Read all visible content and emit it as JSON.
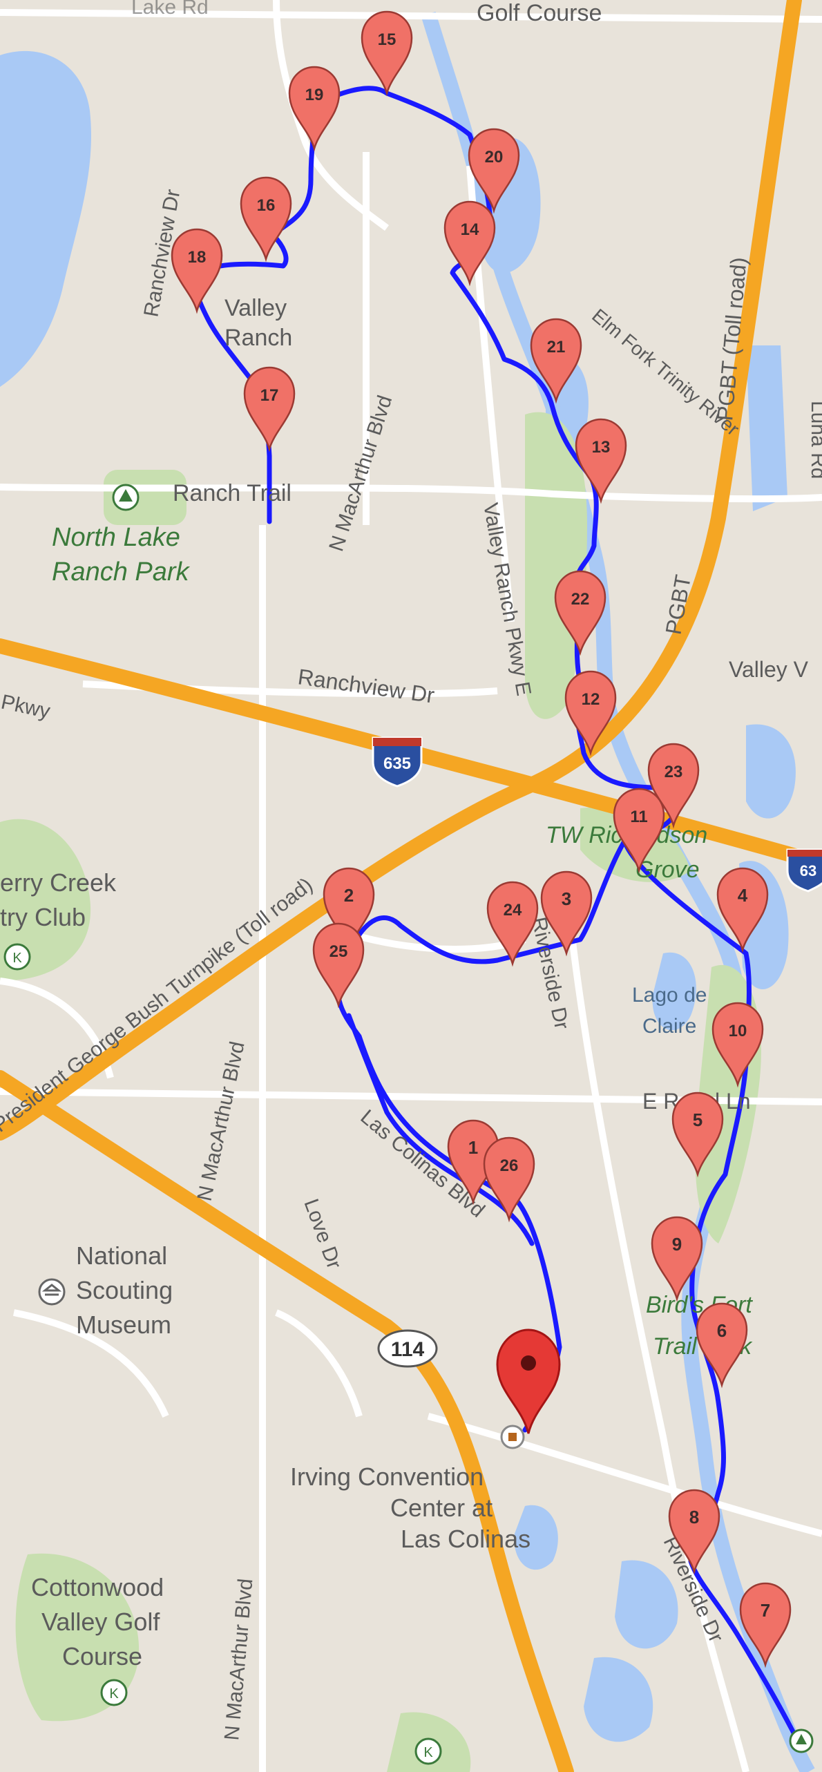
{
  "map": {
    "labels": {
      "golf_course_top": "Golf Course",
      "line_rd_top": "Lake Rd",
      "ranchview_dr_vertical": "Ranchview Dr",
      "valley_ranch": [
        "Valley",
        "Ranch"
      ],
      "n_macarthur_blvd_top": "N MacArthur Blvd",
      "valley_ranch_pkwy_e": "Valley Ranch Pkwy E",
      "elm_fork": "Elm Fork Trinity River",
      "pgbt_toll": "PGBT (Toll road)",
      "pgbt": "PGBT",
      "luna_rd": "Luna Rd",
      "ranch_trail": "Ranch Trail",
      "north_lake_ranch_park": [
        "North Lake",
        "Ranch Park"
      ],
      "ranchview_dr": "Ranchview Dr",
      "pkwy": "Pkwy",
      "valley_v": "Valley V",
      "shield_635": "635",
      "shield_635_right": "63",
      "tw_richardson_grove": [
        "TW Richardson",
        "Grove"
      ],
      "president_george_bush": "President George Bush Turnpike (Toll road)",
      "berry_creek": [
        "erry Creek",
        "try Club"
      ],
      "riverside_dr": "Riverside Dr",
      "lago_de_claire": [
        "Lago de",
        "Claire"
      ],
      "e_royal_ln": "E Royal Ln",
      "las_colinas_blvd": "Las Colinas Blvd",
      "n_macarthur_blvd_mid": "N MacArthur Blvd",
      "love_dr": "Love Dr",
      "national_scouting_museum": [
        "National",
        "Scouting",
        "Museum"
      ],
      "birds_fort_trail_park": [
        "Bird's Fort",
        "Trail Park"
      ],
      "shield_114": "114",
      "irving_convention": [
        "Irving Convention",
        "Center at",
        "Las Colinas"
      ],
      "n_macarthur_blvd_low": "N MacArthur Blvd",
      "cottonwood": [
        "Cottonwood",
        "Valley Golf",
        "Course"
      ],
      "riverside_dr_low": "Riverside Dr"
    },
    "markers": [
      "1",
      "2",
      "3",
      "4",
      "5",
      "6",
      "7",
      "8",
      "9",
      "10",
      "11",
      "12",
      "13",
      "14",
      "15",
      "16",
      "17",
      "18",
      "19",
      "20",
      "21",
      "22",
      "23",
      "24",
      "25",
      "26"
    ],
    "colors": {
      "route": "#1a1aff",
      "marker": "#f07167",
      "highway": "#f5a623",
      "water": "#a9c9f5",
      "park": "#c8dfb0",
      "land": "#e8e3da"
    }
  }
}
